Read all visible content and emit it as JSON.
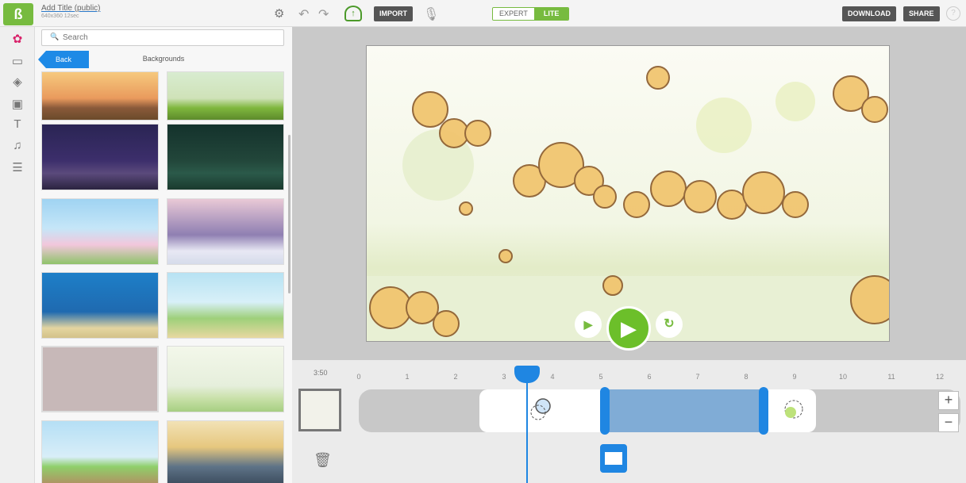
{
  "app": {
    "title": "Add Title",
    "visibility": "(public)",
    "meta": "640x360  12sec"
  },
  "toolbar": {
    "import_label": "IMPORT",
    "mode_expert": "EXPERT",
    "mode_lite": "LITE",
    "download_label": "DOWNLOAD",
    "share_label": "SHARE",
    "help_label": "?"
  },
  "panel": {
    "search_placeholder": "Search",
    "back_label": "Back",
    "title": "Backgrounds"
  },
  "timeline": {
    "time_label": "3:50",
    "ticks": [
      "0",
      "1",
      "2",
      "3",
      "4",
      "5",
      "6",
      "7",
      "8",
      "9",
      "10",
      "11",
      "12"
    ],
    "plus": "+",
    "minus": "−"
  },
  "colors": {
    "accent_green": "#77bb3f",
    "accent_blue": "#1f86e2"
  }
}
